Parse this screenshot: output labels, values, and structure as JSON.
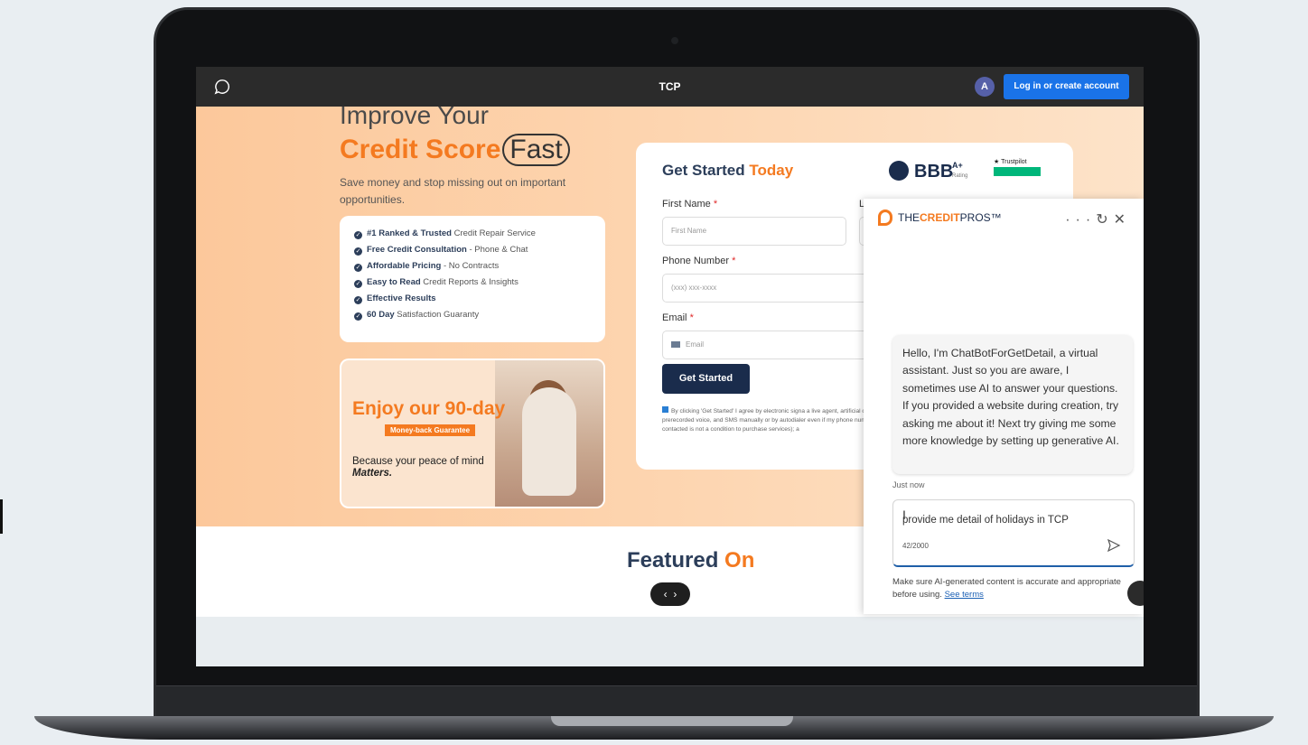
{
  "topbar": {
    "title": "TCP",
    "avatar_letter": "A",
    "login_label": "Log in or create account"
  },
  "hero": {
    "headline_line1": "Improve Your",
    "headline_accent": "Credit Score",
    "headline_circled": "Fast",
    "subtitle": "Save money and stop missing out on important opportunities.",
    "benefits": [
      {
        "bold": "#1 Ranked & Trusted",
        "rest": " Credit Repair Service"
      },
      {
        "bold": "Free Credit Consultation",
        "rest": " - Phone & Chat"
      },
      {
        "bold": "Affordable Pricing",
        "rest": " - No Contracts"
      },
      {
        "bold": "Easy to Read",
        "rest": " Credit Reports & Insights"
      },
      {
        "bold": "Effective Results",
        "rest": ""
      },
      {
        "bold": "60 Day",
        "rest": " Satisfaction Guaranty"
      }
    ],
    "promo": {
      "title": "Enjoy our 90-day",
      "badge": "Money-back Guarantee",
      "text": "Because your peace of mind",
      "text_emph": "Matters."
    }
  },
  "form": {
    "title": "Get Started",
    "title_accent": "Today",
    "bbb_label": "BBB",
    "bbb_rating": "A+",
    "bbb_rating_caption": "Rating",
    "trustpilot_label": "Trustpilot",
    "first_name_label": "First Name",
    "first_name_placeholder": "First Name",
    "last_name_label": "L",
    "phone_label": "Phone Number",
    "phone_placeholder": "(xxx) xxx-xxxx",
    "email_label": "Email",
    "email_placeholder": "Email",
    "required_mark": "*",
    "submit_label": "Get Started",
    "consent": "By clicking 'Get Started' I agree by electronic signa a live agent, artificial or prerecorded voice, and SMS manually or by autodialer even if my phone number contacted is not a condition to purchase services); a"
  },
  "featured": {
    "title": "Featured",
    "title_accent": "On",
    "prev": "‹",
    "next": "›"
  },
  "chat": {
    "brand_prefix": "THE",
    "brand_accent": "CREDIT",
    "brand_suffix": "PROS™",
    "more": "···",
    "refresh": "↻",
    "close": "✕",
    "bot_message": "Hello, I'm ChatBotForGetDetail, a virtual assistant. Just so you are aware, I sometimes use AI to answer your questions. If you provided a website during creation, try asking me about it! Next try giving me some more knowledge by setting up generative AI.",
    "timestamp": "Just now",
    "input_value": "provide me detail of holidays in TCP",
    "counter": "42/2000",
    "disclaimer": "Make sure AI-generated content is accurate and appropriate before using.",
    "terms_link": "See terms"
  }
}
